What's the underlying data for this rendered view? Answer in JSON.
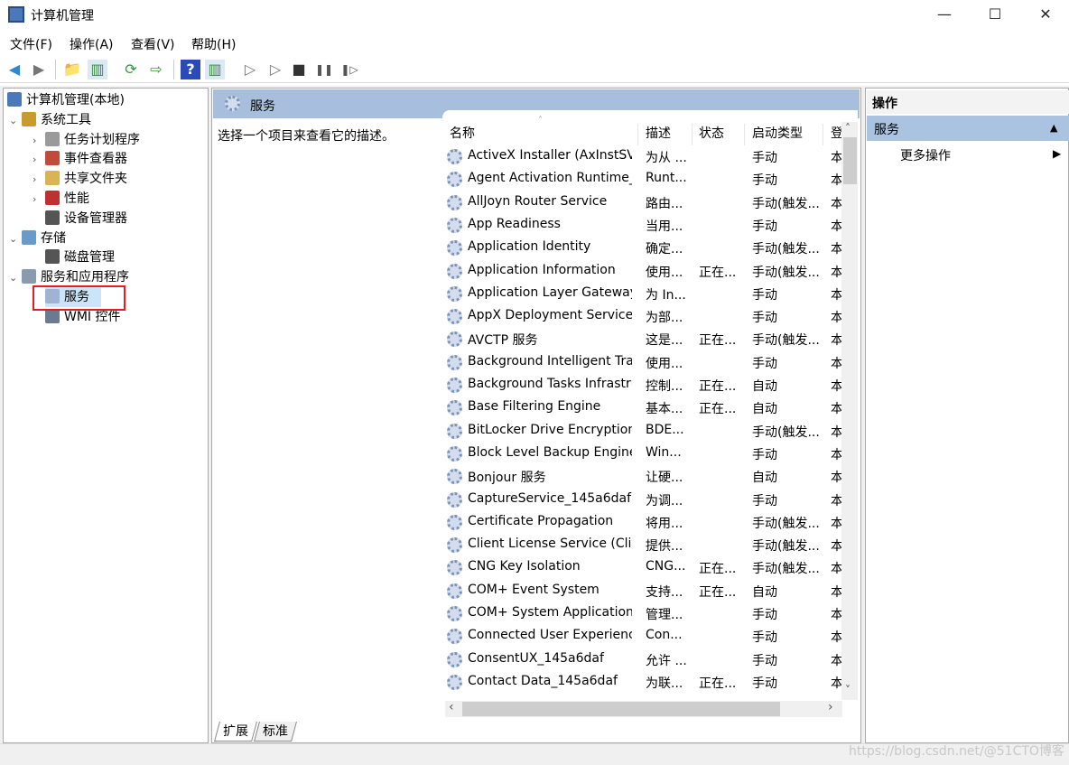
{
  "window": {
    "title": "计算机管理",
    "minimize": "—",
    "maximize": "☐",
    "close": "✕"
  },
  "menu": [
    "文件(F)",
    "操作(A)",
    "查看(V)",
    "帮助(H)"
  ],
  "toolbar": {
    "back": "◀",
    "forward": "▶",
    "up": "📁",
    "show_hide": "▥",
    "refresh": "⟳",
    "export": "⇨",
    "help": "?",
    "view": "▥",
    "start": "▷",
    "start2": "▷",
    "stop": "■",
    "pause": "❚❚",
    "resume": "❚▷"
  },
  "tree": [
    {
      "label": "计算机管理(本地)",
      "level": 0,
      "exp": "",
      "color": "#4a78b8"
    },
    {
      "label": "系统工具",
      "level": 1,
      "exp": "⌄",
      "color": "#c99a2e"
    },
    {
      "label": "任务计划程序",
      "level": 2,
      "exp": "›",
      "color": "#9a9a9a"
    },
    {
      "label": "事件查看器",
      "level": 2,
      "exp": "›",
      "color": "#c24a3a"
    },
    {
      "label": "共享文件夹",
      "level": 2,
      "exp": "›",
      "color": "#d8b552"
    },
    {
      "label": "性能",
      "level": 2,
      "exp": "›",
      "color": "#c03030"
    },
    {
      "label": "设备管理器",
      "level": 2,
      "exp": "",
      "color": "#555"
    },
    {
      "label": "存储",
      "level": 1,
      "exp": "⌄",
      "color": "#6a9ac8"
    },
    {
      "label": "磁盘管理",
      "level": 2,
      "exp": "",
      "color": "#555"
    },
    {
      "label": "服务和应用程序",
      "level": 1,
      "exp": "⌄",
      "color": "#8a9ab0"
    },
    {
      "label": "服务",
      "level": 2,
      "exp": "",
      "color": "#9fb4d4"
    },
    {
      "label": "WMI 控件",
      "level": 2,
      "exp": "",
      "color": "#6a7a90"
    }
  ],
  "center": {
    "title": "服务",
    "description": "选择一个项目来查看它的描述。"
  },
  "columns": [
    "名称",
    "描述",
    "状态",
    "启动类型",
    "登"
  ],
  "sort_indicator": "˄",
  "services": [
    [
      "ActiveX Installer (AxInstSV)",
      "为从 ...",
      "",
      "手动",
      "本"
    ],
    [
      "Agent Activation Runtime_...",
      "Runt...",
      "",
      "手动",
      "本"
    ],
    [
      "AllJoyn Router Service",
      "路由...",
      "",
      "手动(触发...",
      "本"
    ],
    [
      "App Readiness",
      "当用...",
      "",
      "手动",
      "本"
    ],
    [
      "Application Identity",
      "确定...",
      "",
      "手动(触发...",
      "本"
    ],
    [
      "Application Information",
      "使用...",
      "正在...",
      "手动(触发...",
      "本"
    ],
    [
      "Application Layer Gateway ...",
      "为 In...",
      "",
      "手动",
      "本"
    ],
    [
      "AppX Deployment Service ...",
      "为部...",
      "",
      "手动",
      "本"
    ],
    [
      "AVCTP 服务",
      "这是...",
      "正在...",
      "手动(触发...",
      "本"
    ],
    [
      "Background Intelligent Tra...",
      "使用...",
      "",
      "手动",
      "本"
    ],
    [
      "Background Tasks Infrastru...",
      "控制...",
      "正在...",
      "自动",
      "本"
    ],
    [
      "Base Filtering Engine",
      "基本...",
      "正在...",
      "自动",
      "本"
    ],
    [
      "BitLocker Drive Encryption ...",
      "BDE...",
      "",
      "手动(触发...",
      "本"
    ],
    [
      "Block Level Backup Engine ...",
      "Win...",
      "",
      "手动",
      "本"
    ],
    [
      "Bonjour 服务",
      "让硬...",
      "",
      "自动",
      "本"
    ],
    [
      "CaptureService_145a6daf",
      "为调...",
      "",
      "手动",
      "本"
    ],
    [
      "Certificate Propagation",
      "将用...",
      "",
      "手动(触发...",
      "本"
    ],
    [
      "Client License Service (Clip...",
      "提供...",
      "",
      "手动(触发...",
      "本"
    ],
    [
      "CNG Key Isolation",
      "CNG...",
      "正在...",
      "手动(触发...",
      "本"
    ],
    [
      "COM+ Event System",
      "支持...",
      "正在...",
      "自动",
      "本"
    ],
    [
      "COM+ System Application",
      "管理...",
      "",
      "手动",
      "本"
    ],
    [
      "Connected User Experienc...",
      "Con...",
      "",
      "手动",
      "本"
    ],
    [
      "ConsentUX_145a6daf",
      "允许 ...",
      "",
      "手动",
      "本"
    ],
    [
      "Contact Data_145a6daf",
      "为联...",
      "正在...",
      "手动",
      "本"
    ]
  ],
  "scroll": {
    "up": "˄",
    "down": "˅",
    "left": "‹",
    "right": "›"
  },
  "tabs": [
    "扩展",
    "标准"
  ],
  "actions": {
    "header": "操作",
    "section": "服务",
    "section_arrow": "▲",
    "more": "更多操作",
    "more_arrow": "▶"
  },
  "watermark": "https://blog.csdn.net/@51CTO博客",
  "colors": {
    "header_blue": "#a7bfdc",
    "selection": "#cce4f7",
    "highlight_box": "#e02020"
  }
}
